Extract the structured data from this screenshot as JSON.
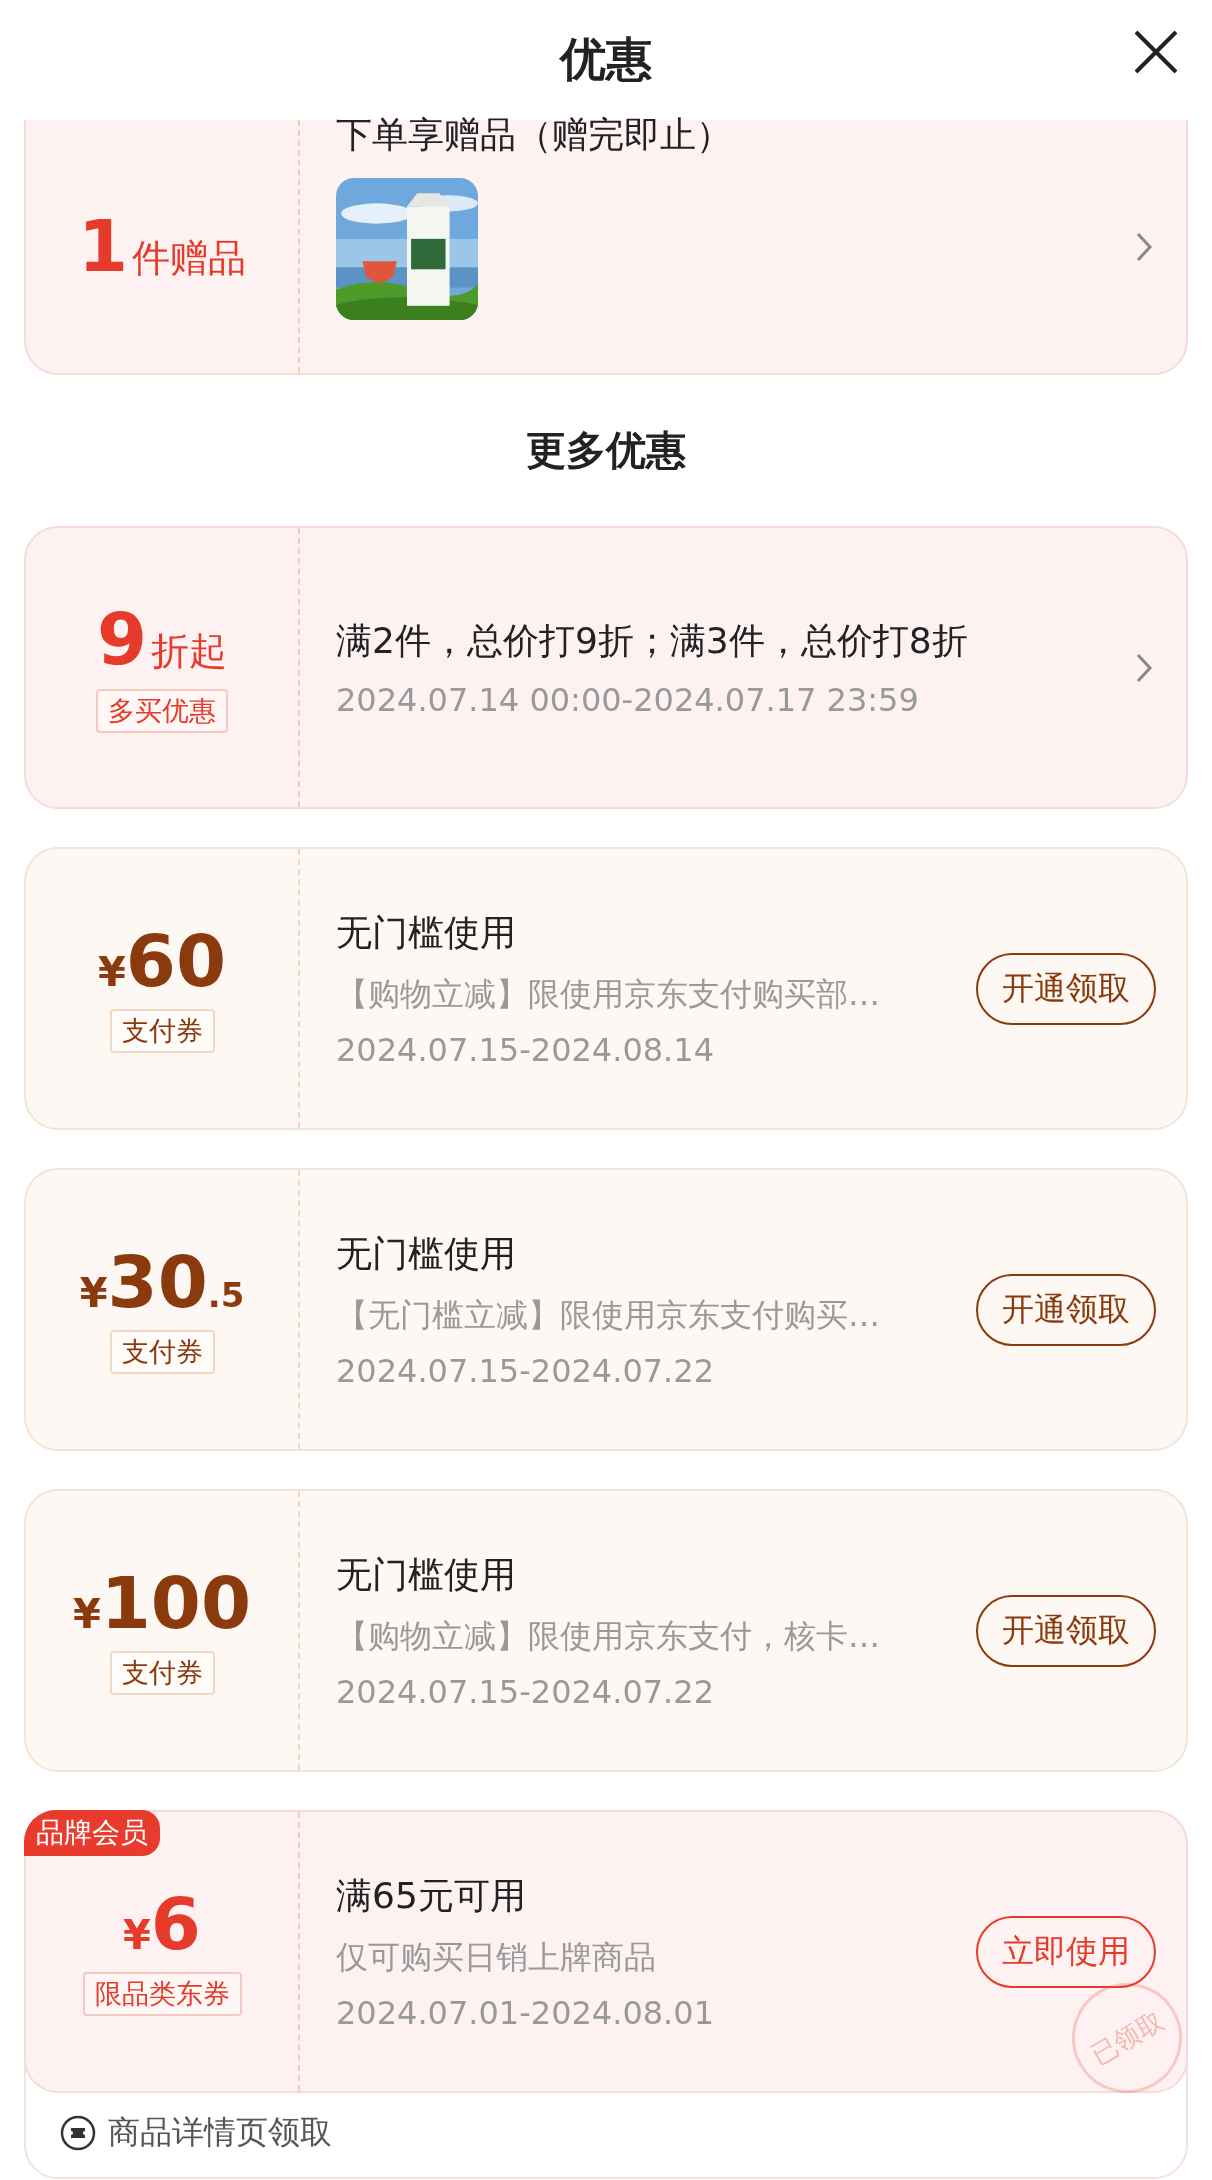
{
  "header": {
    "title": "优惠"
  },
  "gift": {
    "count": "1",
    "unit": "件赠品",
    "title": "下单享赠品（赠完即止）"
  },
  "section_title": "更多优惠",
  "offers": [
    {
      "kind": "discount",
      "amount": "9",
      "unit": "折起",
      "tag": "多买优惠",
      "title": "满2件，总价打9折；满3件，总价打8折",
      "date": "2024.07.14 00:00-2024.07.17 23:59"
    },
    {
      "kind": "pay",
      "currency": "¥",
      "amount": "60",
      "tag": "支付券",
      "title": "无门槛使用",
      "desc": "【购物立减】限使用京东支付购买部…",
      "date": "2024.07.15-2024.08.14",
      "button": "开通领取"
    },
    {
      "kind": "pay",
      "currency": "¥",
      "amount": "30",
      "decimal": ".5",
      "tag": "支付券",
      "title": "无门槛使用",
      "desc": "【无门槛立减】限使用京东支付购买…",
      "date": "2024.07.15-2024.07.22",
      "button": "开通领取"
    },
    {
      "kind": "pay",
      "currency": "¥",
      "amount": "100",
      "tag": "支付券",
      "title": "无门槛使用",
      "desc": "【购物立减】限使用京东支付，核卡…",
      "date": "2024.07.15-2024.07.22",
      "button": "开通领取"
    },
    {
      "kind": "member",
      "badge": "品牌会员",
      "currency": "¥",
      "amount": "6",
      "tag": "限品类东券",
      "title": "满65元可用",
      "desc": "仅可购买日销上牌商品",
      "date": "2024.07.01-2024.08.01",
      "button": "立即使用",
      "stamp": "已领取",
      "footer": "商品详情页领取"
    }
  ]
}
